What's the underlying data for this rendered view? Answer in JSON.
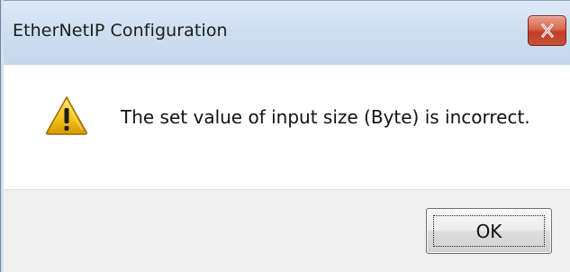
{
  "window": {
    "title": "EtherNetIP Configuration",
    "close_icon": "close-x",
    "close_button_color": "#c94a33"
  },
  "dialog": {
    "icon": "warning-triangle",
    "message": "The set value of input size (Byte) is incorrect."
  },
  "buttons": {
    "ok_label": "OK"
  }
}
